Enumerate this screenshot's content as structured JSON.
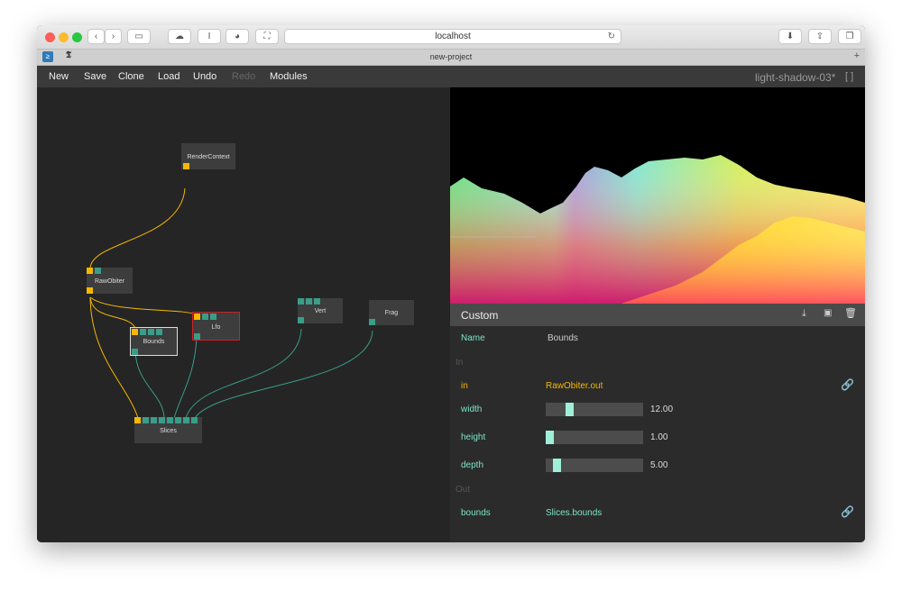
{
  "browser": {
    "url": "localhost",
    "tab_title": "new-project"
  },
  "menu": {
    "items": [
      {
        "label": "New",
        "enabled": true
      },
      {
        "label": "Save",
        "enabled": true
      },
      {
        "label": "Clone",
        "enabled": true
      },
      {
        "label": "Load",
        "enabled": true
      },
      {
        "label": "Undo",
        "enabled": true
      },
      {
        "label": "Redo",
        "enabled": false
      },
      {
        "label": "Modules",
        "enabled": true
      }
    ],
    "project_name": "light-shadow-03*",
    "fullscreen_label": "[ ]"
  },
  "graph": {
    "nodes": {
      "render_context": "RenderContext",
      "raw_obiter": "RawObiter",
      "bounds": "Bounds",
      "lfo": "Lfo",
      "vert": "Vert",
      "frag": "Frag",
      "slices": "Slices"
    }
  },
  "inspector": {
    "title": "Custom",
    "name_label": "Name",
    "name_value": "Bounds",
    "in_section": "In",
    "out_section": "Out",
    "inputs": [
      {
        "label": "in",
        "value": "RawObiter.out"
      },
      {
        "label": "width",
        "value": "12.00",
        "fraction": 0.22
      },
      {
        "label": "height",
        "value": "1.00",
        "fraction": 0.0
      },
      {
        "label": "depth",
        "value": "5.00",
        "fraction": 0.08
      }
    ],
    "outputs": [
      {
        "label": "bounds",
        "value": "Slices.bounds"
      }
    ]
  },
  "colors": {
    "accent_green": "#7de5c8",
    "port_yellow": "#f5b800",
    "port_teal": "#3a9d88",
    "selected_red": "#d0202a"
  }
}
